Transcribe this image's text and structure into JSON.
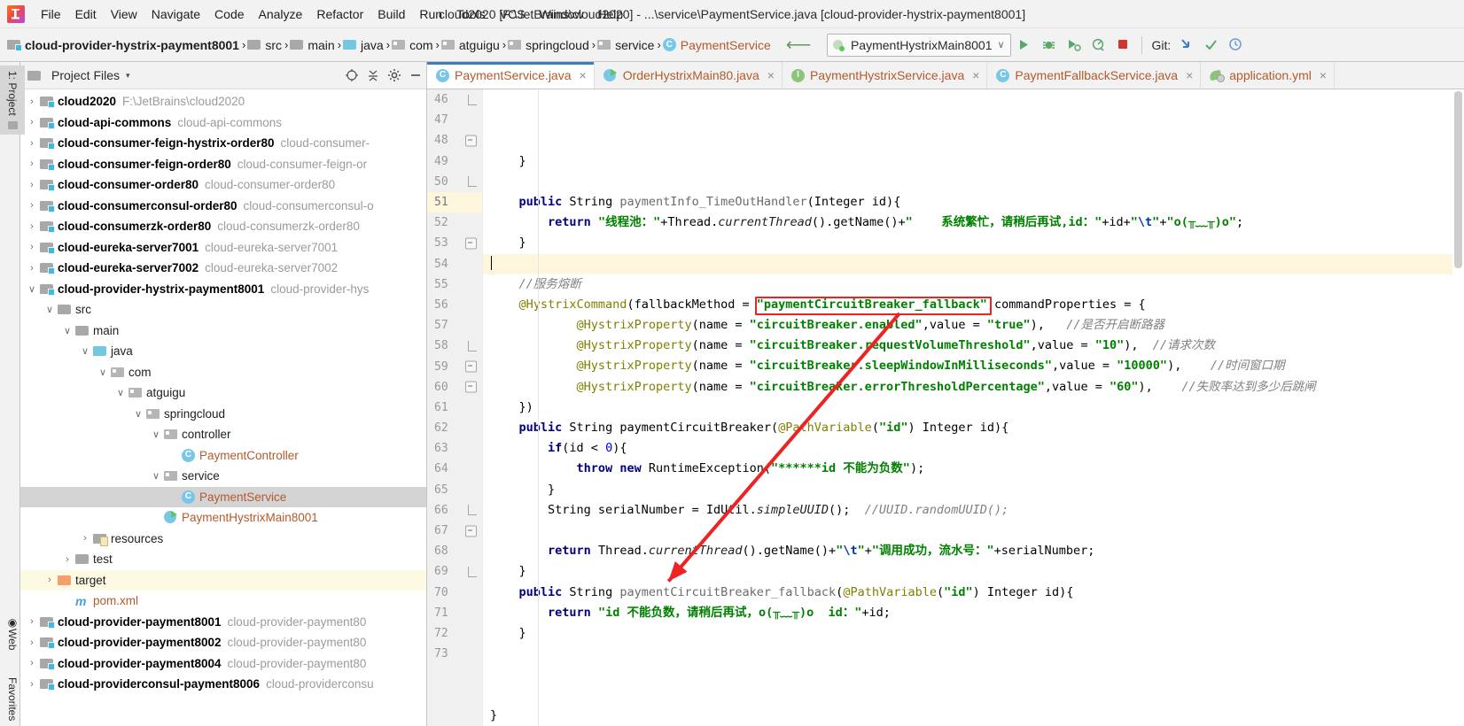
{
  "window": {
    "title": "cloud2020 [F:\\JetBrains\\cloud2020] - ...\\service\\PaymentService.java [cloud-provider-hystrix-payment8001]"
  },
  "menubar": {
    "items": [
      {
        "label": "File"
      },
      {
        "label": "Edit"
      },
      {
        "label": "View"
      },
      {
        "label": "Navigate"
      },
      {
        "label": "Code"
      },
      {
        "label": "Analyze"
      },
      {
        "label": "Refactor"
      },
      {
        "label": "Build"
      },
      {
        "label": "Run"
      },
      {
        "label": "Tools"
      },
      {
        "label": "VCS"
      },
      {
        "label": "Window"
      },
      {
        "label": "Help"
      }
    ]
  },
  "navbar": {
    "breadcrumbs": [
      {
        "label": "cloud-provider-hystrix-payment8001",
        "icon": "module-icon",
        "kind": "module"
      },
      {
        "label": "src",
        "icon": "folder-icon",
        "kind": "folder"
      },
      {
        "label": "main",
        "icon": "folder-icon",
        "kind": "folder"
      },
      {
        "label": "java",
        "icon": "source-folder-icon",
        "kind": "sourcefolder"
      },
      {
        "label": "com",
        "icon": "package-icon",
        "kind": "package"
      },
      {
        "label": "atguigu",
        "icon": "package-icon",
        "kind": "package"
      },
      {
        "label": "springcloud",
        "icon": "package-icon",
        "kind": "package"
      },
      {
        "label": "service",
        "icon": "package-icon",
        "kind": "package"
      },
      {
        "label": "PaymentService",
        "icon": "class-icon",
        "kind": "class"
      }
    ],
    "run_config": {
      "name": "PaymentHystrixMain8001",
      "chevron": "∨"
    },
    "git_label": "Git:"
  },
  "toolwindows": {
    "left": [
      {
        "label": "1: Project",
        "active": true
      },
      {
        "label": "Web",
        "active": false
      },
      {
        "label": "Favorites",
        "active": false
      }
    ]
  },
  "project_panel": {
    "title": "Project Files",
    "caret": "▾",
    "tree": [
      {
        "indent": 0,
        "arrow": "›",
        "icon": "module-icon",
        "name": "cloud2020",
        "loc": "F:\\JetBrains\\cloud2020",
        "bold": true
      },
      {
        "indent": 0,
        "arrow": "›",
        "icon": "module-icon",
        "name": "cloud-api-commons",
        "loc": "cloud-api-commons",
        "bold": true
      },
      {
        "indent": 0,
        "arrow": "›",
        "icon": "module-icon",
        "name": "cloud-consumer-feign-hystrix-order80",
        "loc": "cloud-consumer-",
        "bold": true
      },
      {
        "indent": 0,
        "arrow": "›",
        "icon": "module-icon",
        "name": "cloud-consumer-feign-order80",
        "loc": "cloud-consumer-feign-or",
        "bold": true
      },
      {
        "indent": 0,
        "arrow": "›",
        "icon": "module-icon",
        "name": "cloud-consumer-order80",
        "loc": "cloud-consumer-order80",
        "bold": true
      },
      {
        "indent": 0,
        "arrow": "›",
        "icon": "module-icon",
        "name": "cloud-consumerconsul-order80",
        "loc": "cloud-consumerconsul-o",
        "bold": true
      },
      {
        "indent": 0,
        "arrow": "›",
        "icon": "module-icon",
        "name": "cloud-consumerzk-order80",
        "loc": "cloud-consumerzk-order80",
        "bold": true
      },
      {
        "indent": 0,
        "arrow": "›",
        "icon": "module-icon",
        "name": "cloud-eureka-server7001",
        "loc": "cloud-eureka-server7001",
        "bold": true
      },
      {
        "indent": 0,
        "arrow": "›",
        "icon": "module-icon",
        "name": "cloud-eureka-server7002",
        "loc": "cloud-eureka-server7002",
        "bold": true
      },
      {
        "indent": 0,
        "arrow": "∨",
        "icon": "module-icon",
        "name": "cloud-provider-hystrix-payment8001",
        "loc": "cloud-provider-hys",
        "bold": true
      },
      {
        "indent": 1,
        "arrow": "∨",
        "icon": "folder-icon",
        "name": "src",
        "loc": "",
        "bold": false
      },
      {
        "indent": 2,
        "arrow": "∨",
        "icon": "folder-icon",
        "name": "main",
        "loc": "",
        "bold": false
      },
      {
        "indent": 3,
        "arrow": "∨",
        "icon": "source-folder-icon",
        "name": "java",
        "loc": "",
        "bold": false
      },
      {
        "indent": 4,
        "arrow": "∨",
        "icon": "package-icon",
        "name": "com",
        "loc": "",
        "bold": false
      },
      {
        "indent": 5,
        "arrow": "∨",
        "icon": "package-icon",
        "name": "atguigu",
        "loc": "",
        "bold": false
      },
      {
        "indent": 6,
        "arrow": "∨",
        "icon": "package-icon",
        "name": "springcloud",
        "loc": "",
        "bold": false
      },
      {
        "indent": 7,
        "arrow": "∨",
        "icon": "package-icon",
        "name": "controller",
        "loc": "",
        "bold": false
      },
      {
        "indent": 8,
        "arrow": "",
        "icon": "class-icon",
        "name": "PaymentController",
        "loc": "",
        "bold": false,
        "cls": true
      },
      {
        "indent": 7,
        "arrow": "∨",
        "icon": "package-icon",
        "name": "service",
        "loc": "",
        "bold": false
      },
      {
        "indent": 8,
        "arrow": "",
        "icon": "class-icon",
        "name": "PaymentService",
        "loc": "",
        "bold": false,
        "cls": true,
        "selected": true
      },
      {
        "indent": 7,
        "arrow": "",
        "icon": "spring-main-icon",
        "name": "PaymentHystrixMain8001",
        "loc": "",
        "bold": false,
        "cls": true
      },
      {
        "indent": 3,
        "arrow": "›",
        "icon": "resource-folder-icon",
        "name": "resources",
        "loc": "",
        "bold": false
      },
      {
        "indent": 2,
        "arrow": "›",
        "icon": "folder-icon",
        "name": "test",
        "loc": "",
        "bold": false
      },
      {
        "indent": 1,
        "arrow": "›",
        "icon": "target-folder-icon",
        "name": "target",
        "loc": "",
        "bold": false,
        "highlight": true
      },
      {
        "indent": 2,
        "arrow": "",
        "icon": "maven-icon",
        "name": "pom.xml",
        "loc": "",
        "bold": false,
        "cls": true
      },
      {
        "indent": 0,
        "arrow": "›",
        "icon": "module-icon",
        "name": "cloud-provider-payment8001",
        "loc": "cloud-provider-payment80",
        "bold": true
      },
      {
        "indent": 0,
        "arrow": "›",
        "icon": "module-icon",
        "name": "cloud-provider-payment8002",
        "loc": "cloud-provider-payment80",
        "bold": true
      },
      {
        "indent": 0,
        "arrow": "›",
        "icon": "module-icon",
        "name": "cloud-provider-payment8004",
        "loc": "cloud-provider-payment80",
        "bold": true
      },
      {
        "indent": 0,
        "arrow": "›",
        "icon": "module-icon",
        "name": "cloud-providerconsul-payment8006",
        "loc": "cloud-providerconsu",
        "bold": true
      }
    ]
  },
  "editor": {
    "tabs": [
      {
        "label": "PaymentService.java",
        "icon": "class-icon",
        "active": true,
        "close": "×"
      },
      {
        "label": "OrderHystrixMain80.java",
        "icon": "spring-class-icon",
        "active": false,
        "close": "×"
      },
      {
        "label": "PaymentHystrixService.java",
        "icon": "interface-icon",
        "active": false,
        "close": "×"
      },
      {
        "label": "PaymentFallbackService.java",
        "icon": "class-icon",
        "active": false,
        "close": "×"
      },
      {
        "label": "application.yml",
        "icon": "yaml-icon",
        "active": false,
        "close": "×"
      }
    ],
    "first_line": 46,
    "current_line": 51,
    "lines": [
      {
        "n": 46,
        "fold": "end",
        "tokens": [
          {
            "t": "    }",
            "c": "plain"
          }
        ]
      },
      {
        "n": 47,
        "fold": "",
        "tokens": []
      },
      {
        "n": 48,
        "fold": "start",
        "tokens": [
          {
            "t": "    ",
            "c": "plain"
          },
          {
            "t": "public",
            "c": "kw"
          },
          {
            "t": " String ",
            "c": "plain"
          },
          {
            "t": "paymentInfo_TimeOutHandler",
            "c": "decl"
          },
          {
            "t": "(Integer id){",
            "c": "plain"
          }
        ]
      },
      {
        "n": 49,
        "fold": "",
        "tokens": [
          {
            "t": "        ",
            "c": "plain"
          },
          {
            "t": "return",
            "c": "kw"
          },
          {
            "t": " ",
            "c": "plain"
          },
          {
            "t": "\"线程池：\"",
            "c": "str"
          },
          {
            "t": "+Thread.",
            "c": "plain"
          },
          {
            "t": "currentThread",
            "c": "ital"
          },
          {
            "t": "().getName()+",
            "c": "plain"
          },
          {
            "t": "\"    系统繁忙，请稍后再试,id：\"",
            "c": "str"
          },
          {
            "t": "+id+",
            "c": "plain"
          },
          {
            "t": "\"",
            "c": "str"
          },
          {
            "t": "\\t",
            "c": "esc"
          },
          {
            "t": "\"",
            "c": "str"
          },
          {
            "t": "+",
            "c": "plain"
          },
          {
            "t": "\"o(╥﹏╥)o\"",
            "c": "str"
          },
          {
            "t": ";",
            "c": "plain"
          }
        ]
      },
      {
        "n": 50,
        "fold": "end",
        "tokens": [
          {
            "t": "    }",
            "c": "plain"
          }
        ]
      },
      {
        "n": 51,
        "fold": "",
        "tokens": [],
        "current": true
      },
      {
        "n": 52,
        "fold": "",
        "tokens": [
          {
            "t": "    //服务熔断",
            "c": "cmt"
          }
        ]
      },
      {
        "n": 53,
        "fold": "start",
        "tokens": [
          {
            "t": "    ",
            "c": "plain"
          },
          {
            "t": "@HystrixCommand",
            "c": "anno"
          },
          {
            "t": "(fallbackMethod = ",
            "c": "plain"
          },
          {
            "t": "\"paymentCircuitBreaker_fallback\"",
            "c": "str"
          },
          {
            "t": ",commandProperties = {",
            "c": "plain"
          }
        ]
      },
      {
        "n": 54,
        "fold": "",
        "tokens": [
          {
            "t": "            ",
            "c": "plain"
          },
          {
            "t": "@HystrixProperty",
            "c": "anno"
          },
          {
            "t": "(name = ",
            "c": "plain"
          },
          {
            "t": "\"circuitBreaker.enabled\"",
            "c": "str"
          },
          {
            "t": ",value = ",
            "c": "plain"
          },
          {
            "t": "\"true\"",
            "c": "str"
          },
          {
            "t": "),   ",
            "c": "plain"
          },
          {
            "t": "//是否开启断路器",
            "c": "cmt"
          }
        ]
      },
      {
        "n": 55,
        "fold": "",
        "tokens": [
          {
            "t": "            ",
            "c": "plain"
          },
          {
            "t": "@HystrixProperty",
            "c": "anno"
          },
          {
            "t": "(name = ",
            "c": "plain"
          },
          {
            "t": "\"circuitBreaker.requestVolumeThreshold\"",
            "c": "str"
          },
          {
            "t": ",value = ",
            "c": "plain"
          },
          {
            "t": "\"10\"",
            "c": "str"
          },
          {
            "t": "),  ",
            "c": "plain"
          },
          {
            "t": "//请求次数",
            "c": "cmt"
          }
        ]
      },
      {
        "n": 56,
        "fold": "",
        "tokens": [
          {
            "t": "            ",
            "c": "plain"
          },
          {
            "t": "@HystrixProperty",
            "c": "anno"
          },
          {
            "t": "(name = ",
            "c": "plain"
          },
          {
            "t": "\"circuitBreaker.sleepWindowInMilliseconds\"",
            "c": "str"
          },
          {
            "t": ",value = ",
            "c": "plain"
          },
          {
            "t": "\"10000\"",
            "c": "str"
          },
          {
            "t": "),    ",
            "c": "plain"
          },
          {
            "t": "//时间窗口期",
            "c": "cmt"
          }
        ]
      },
      {
        "n": 57,
        "fold": "",
        "tokens": [
          {
            "t": "            ",
            "c": "plain"
          },
          {
            "t": "@HystrixProperty",
            "c": "anno"
          },
          {
            "t": "(name = ",
            "c": "plain"
          },
          {
            "t": "\"circuitBreaker.errorThresholdPercentage\"",
            "c": "str"
          },
          {
            "t": ",value = ",
            "c": "plain"
          },
          {
            "t": "\"60\"",
            "c": "str"
          },
          {
            "t": "),    ",
            "c": "plain"
          },
          {
            "t": "//失败率达到多少后跳闸",
            "c": "cmt"
          }
        ]
      },
      {
        "n": 58,
        "fold": "end",
        "tokens": [
          {
            "t": "    })",
            "c": "plain"
          }
        ]
      },
      {
        "n": 59,
        "fold": "start",
        "tokens": [
          {
            "t": "    ",
            "c": "plain"
          },
          {
            "t": "public",
            "c": "kw"
          },
          {
            "t": " String paymentCircuitBreaker(",
            "c": "plain"
          },
          {
            "t": "@PathVariable",
            "c": "anno"
          },
          {
            "t": "(",
            "c": "plain"
          },
          {
            "t": "\"id\"",
            "c": "str"
          },
          {
            "t": ") Integer id){",
            "c": "plain"
          }
        ]
      },
      {
        "n": 60,
        "fold": "start",
        "tokens": [
          {
            "t": "        ",
            "c": "plain"
          },
          {
            "t": "if",
            "c": "kw"
          },
          {
            "t": "(id < ",
            "c": "plain"
          },
          {
            "t": "0",
            "c": "num"
          },
          {
            "t": "){",
            "c": "plain"
          }
        ]
      },
      {
        "n": 61,
        "fold": "",
        "tokens": [
          {
            "t": "            ",
            "c": "plain"
          },
          {
            "t": "throw",
            "c": "kw"
          },
          {
            "t": " ",
            "c": "plain"
          },
          {
            "t": "new",
            "c": "kw"
          },
          {
            "t": " RuntimeException(",
            "c": "plain"
          },
          {
            "t": "\"******id 不能为负数\"",
            "c": "str"
          },
          {
            "t": ");",
            "c": "plain"
          }
        ]
      },
      {
        "n": 62,
        "fold": "",
        "tokens": [
          {
            "t": "        }",
            "c": "plain"
          }
        ]
      },
      {
        "n": 63,
        "fold": "",
        "tokens": [
          {
            "t": "        String serialNumber = IdUtil.",
            "c": "plain"
          },
          {
            "t": "simpleUUID",
            "c": "ital"
          },
          {
            "t": "();  ",
            "c": "plain"
          },
          {
            "t": "//UUID.randomUUID();",
            "c": "cmt"
          }
        ]
      },
      {
        "n": 64,
        "fold": "",
        "tokens": []
      },
      {
        "n": 65,
        "fold": "",
        "tokens": [
          {
            "t": "        ",
            "c": "plain"
          },
          {
            "t": "return",
            "c": "kw"
          },
          {
            "t": " Thread.",
            "c": "plain"
          },
          {
            "t": "currentThread",
            "c": "ital"
          },
          {
            "t": "().getName()+",
            "c": "plain"
          },
          {
            "t": "\"",
            "c": "str"
          },
          {
            "t": "\\t",
            "c": "esc"
          },
          {
            "t": "\"",
            "c": "str"
          },
          {
            "t": "+",
            "c": "plain"
          },
          {
            "t": "\"调用成功，流水号：\"",
            "c": "str"
          },
          {
            "t": "+serialNumber;",
            "c": "plain"
          }
        ]
      },
      {
        "n": 66,
        "fold": "end",
        "tokens": [
          {
            "t": "    }",
            "c": "plain"
          }
        ]
      },
      {
        "n": 67,
        "fold": "start",
        "tokens": [
          {
            "t": "    ",
            "c": "plain"
          },
          {
            "t": "public",
            "c": "kw"
          },
          {
            "t": " String ",
            "c": "plain"
          },
          {
            "t": "paymentCircuitBreaker_fallback",
            "c": "decl"
          },
          {
            "t": "(",
            "c": "plain"
          },
          {
            "t": "@PathVariable",
            "c": "anno"
          },
          {
            "t": "(",
            "c": "plain"
          },
          {
            "t": "\"id\"",
            "c": "str"
          },
          {
            "t": ") Integer id){",
            "c": "plain"
          }
        ]
      },
      {
        "n": 68,
        "fold": "",
        "tokens": [
          {
            "t": "        ",
            "c": "plain"
          },
          {
            "t": "return",
            "c": "kw"
          },
          {
            "t": " ",
            "c": "plain"
          },
          {
            "t": "\"id 不能负数，请稍后再试，o(╥﹏╥)o  id：\"",
            "c": "str"
          },
          {
            "t": "+id;",
            "c": "plain"
          }
        ]
      },
      {
        "n": 69,
        "fold": "end",
        "tokens": [
          {
            "t": "    }",
            "c": "plain"
          }
        ]
      },
      {
        "n": 70,
        "fold": "",
        "tokens": []
      },
      {
        "n": 71,
        "fold": "",
        "tokens": []
      },
      {
        "n": 72,
        "fold": "",
        "tokens": []
      },
      {
        "n": 73,
        "fold": "",
        "tokens": [
          {
            "t": "}",
            "c": "plain"
          }
        ]
      }
    ],
    "annotation": {
      "highlight_box_label": "\"paymentCircuitBreaker_fallback\"",
      "arrow_color": "#ee2222",
      "box_color": "#ee2222"
    }
  }
}
